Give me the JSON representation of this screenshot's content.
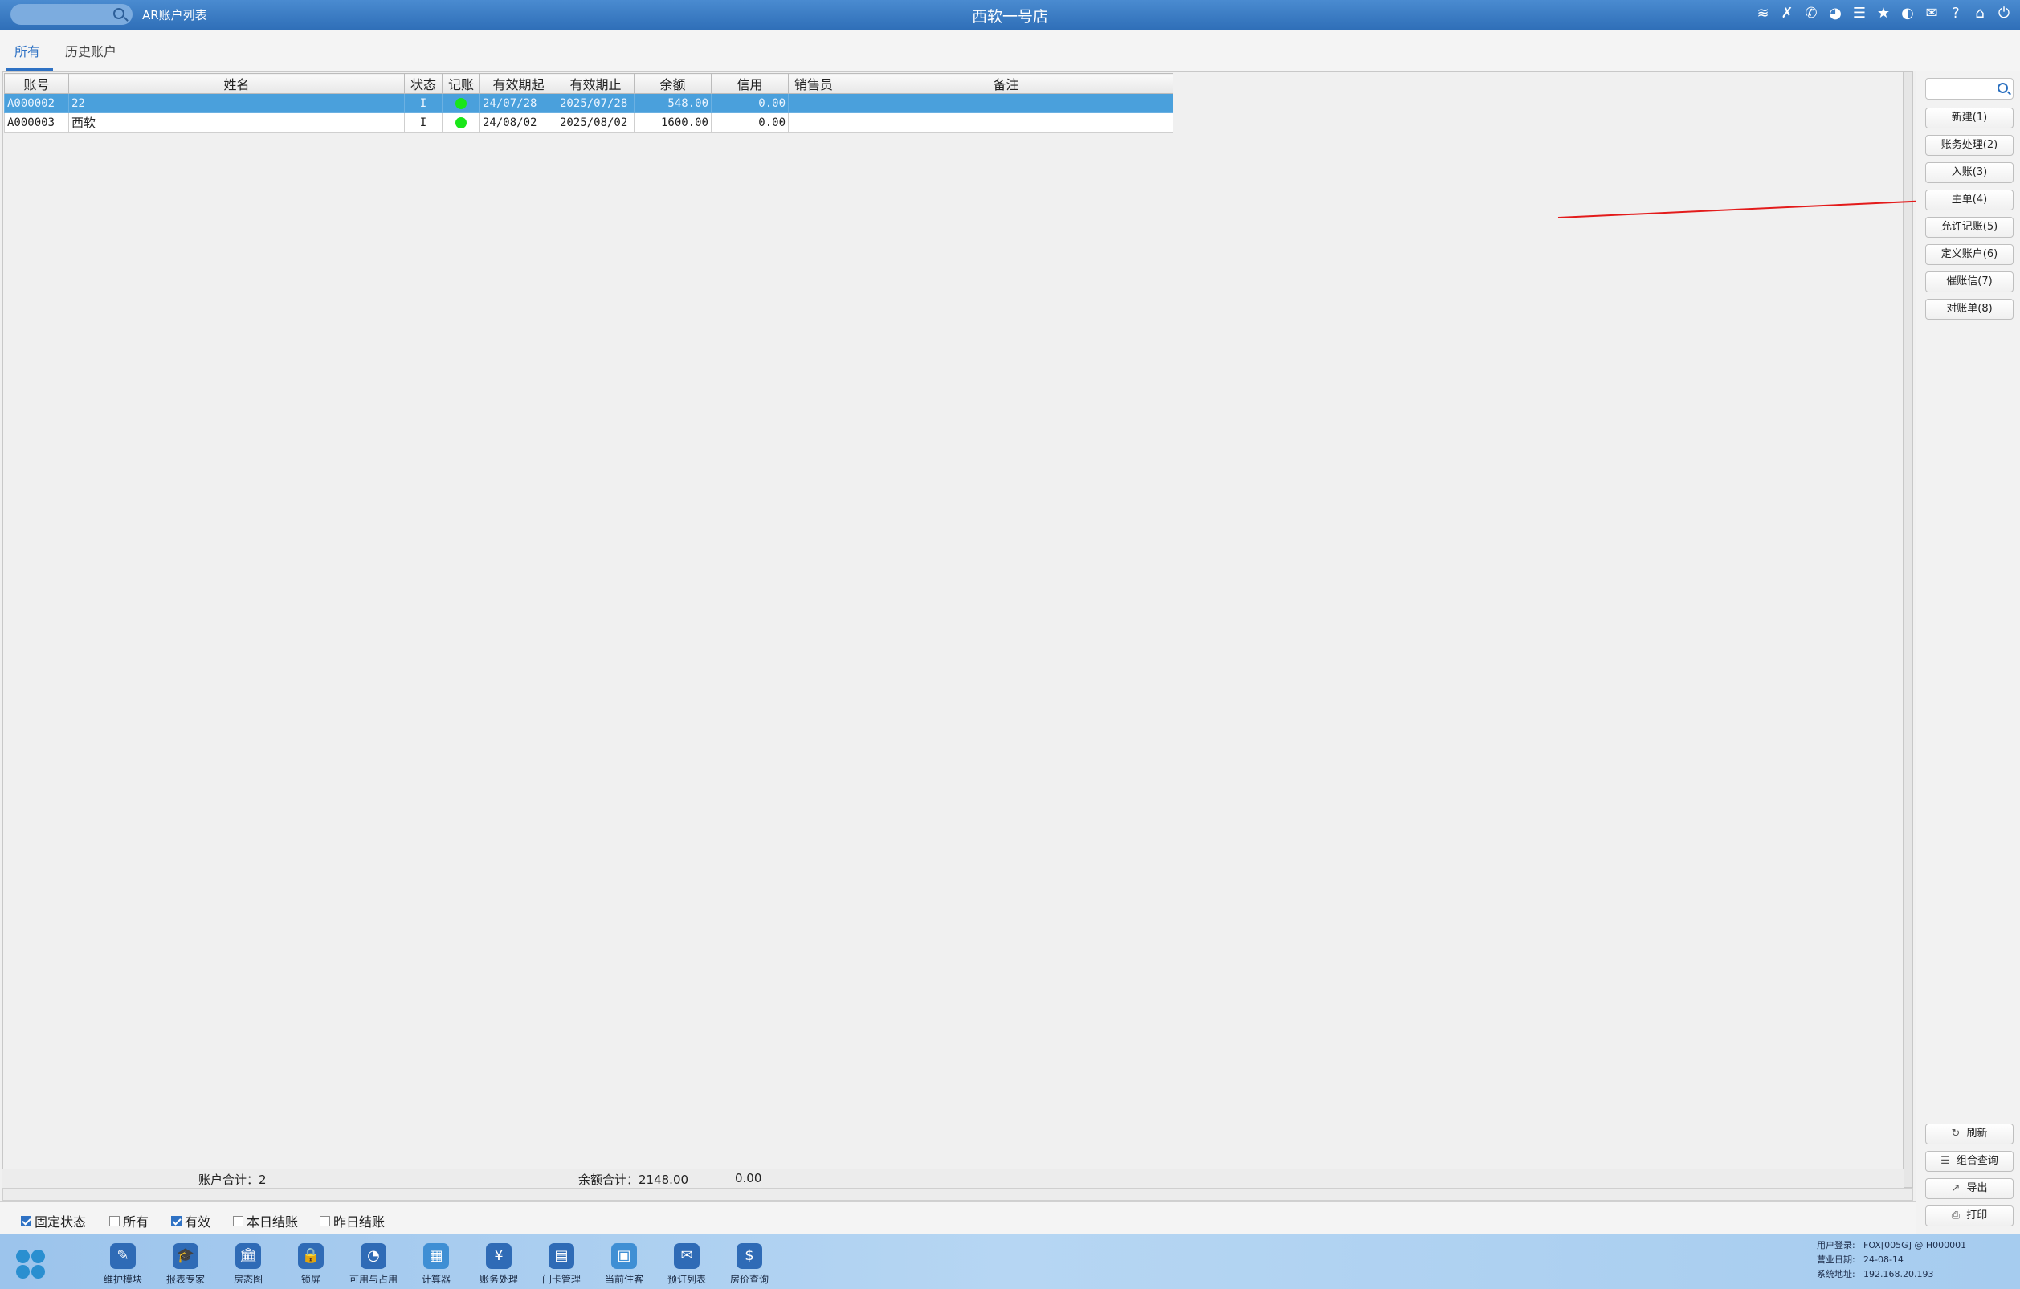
{
  "titlebar": {
    "module": "AR账户列表",
    "title": "西软一号店",
    "icons": [
      "wifi-icon",
      "tools-icon",
      "phone-icon",
      "palette-icon",
      "menu-icon",
      "star-icon",
      "contrast-icon",
      "mail-icon",
      "help-icon",
      "home-icon",
      "power-icon"
    ]
  },
  "tabs": [
    {
      "label": "所有",
      "active": true
    },
    {
      "label": "历史账户",
      "active": false
    }
  ],
  "table": {
    "headers": [
      "账号",
      "姓名",
      "状态",
      "记账",
      "有效期起",
      "有效期止",
      "余额",
      "信用",
      "销售员",
      "备注"
    ],
    "rows": [
      {
        "account": "A000002",
        "name": "22",
        "status": "I",
        "posting": "green",
        "from": "24/07/28",
        "to": "2025/07/28",
        "balance": "548.00",
        "credit": "0.00",
        "sales": "",
        "note": "",
        "selected": true
      },
      {
        "account": "A000003",
        "name": "西软",
        "status": "I",
        "posting": "green",
        "from": "24/08/02",
        "to": "2025/08/02",
        "balance": "1600.00",
        "credit": "0.00",
        "sales": "",
        "note": "",
        "selected": false
      }
    ]
  },
  "summary": {
    "account_total": "账户合计：2",
    "balance_total": "余额合计：2148.00",
    "credit_total": "0.00"
  },
  "sidebar": {
    "search_placeholder": "",
    "buttons": [
      "新建(1)",
      "账务处理(2)",
      "入账(3)",
      "主单(4)",
      "允许记账(5)",
      "定义账户(6)",
      "催账信(7)",
      "对账单(8)"
    ],
    "bottom_buttons": [
      {
        "icon": "↻",
        "label": "刷新"
      },
      {
        "icon": "☰",
        "label": "组合查询"
      },
      {
        "icon": "↗",
        "label": "导出"
      },
      {
        "icon": "⎙",
        "label": "打印"
      }
    ]
  },
  "filters": [
    {
      "label": "固定状态",
      "checked": true
    },
    {
      "label": "所有",
      "checked": false
    },
    {
      "label": "有效",
      "checked": true
    },
    {
      "label": "本日结账",
      "checked": false
    },
    {
      "label": "昨日结账",
      "checked": false
    }
  ],
  "dock": {
    "apps": [
      {
        "label": "维护模块",
        "icon": "✎"
      },
      {
        "label": "报表专家",
        "icon": "🎓"
      },
      {
        "label": "房态图",
        "icon": "🏛"
      },
      {
        "label": "锁屏",
        "icon": "🔒"
      },
      {
        "label": "可用与占用",
        "icon": "◔"
      },
      {
        "label": "计算器",
        "icon": "▦"
      },
      {
        "label": "账务处理",
        "icon": "¥"
      },
      {
        "label": "门卡管理",
        "icon": "▤"
      },
      {
        "label": "当前住客",
        "icon": "▣"
      },
      {
        "label": "预订列表",
        "icon": "✉"
      },
      {
        "label": "房价查询",
        "icon": "$"
      }
    ],
    "sysinfo": {
      "user_label": "用户登录:",
      "user": "FOX[005G] @ H000001",
      "date_label": "营业日期:",
      "date": "24-08-14",
      "addr_label": "系统地址:",
      "addr": "192.168.20.193"
    }
  }
}
